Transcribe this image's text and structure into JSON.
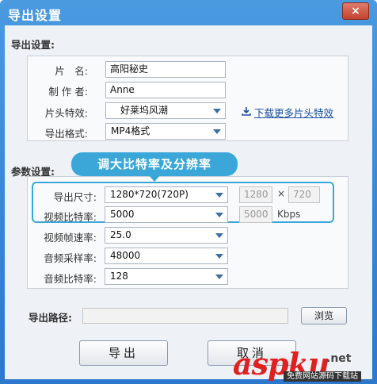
{
  "window": {
    "title": "导出设置",
    "close_glyph": "×"
  },
  "export_settings": {
    "section_label": "导出设置:",
    "name_label": "片　名:",
    "name_value": "高阳秘史",
    "author_label": "制 作 者:",
    "author_value": "Anne",
    "intro_effect_label": "片头特效:",
    "intro_effect_value": "好莱坞风潮",
    "download_link": "下载更多片头特效",
    "format_label": "导出格式:",
    "format_value": "MP4格式"
  },
  "param_settings": {
    "section_label": "参数设置:",
    "callout": "调大比特率及分辨率",
    "size_label": "导出尺寸:",
    "size_value": "1280*720(720P)",
    "width_value": "1280",
    "times_glyph": "×",
    "height_value": "720",
    "bitrate_label": "视频比特率:",
    "bitrate_value": "5000",
    "bitrate_display": "5000",
    "bitrate_unit": "Kbps",
    "framerate_label": "视频帧速率:",
    "framerate_value": "25.0",
    "samplerate_label": "音频采样率:",
    "samplerate_value": "48000",
    "audio_bitrate_label": "音频比特率:",
    "audio_bitrate_value": "128"
  },
  "export_path": {
    "label": "导出路径:",
    "value": "",
    "browse_label": "浏览"
  },
  "actions": {
    "export_label": "导出",
    "cancel_label": "取消"
  },
  "watermark": {
    "brand": "aspku",
    "suffix": ".net",
    "tagline": "免费网站源码下载站"
  },
  "colors": {
    "titlebar": "#2b78cd",
    "highlight": "#3aa7d8",
    "link": "#1a4fa0",
    "watermark": "#e02020"
  }
}
